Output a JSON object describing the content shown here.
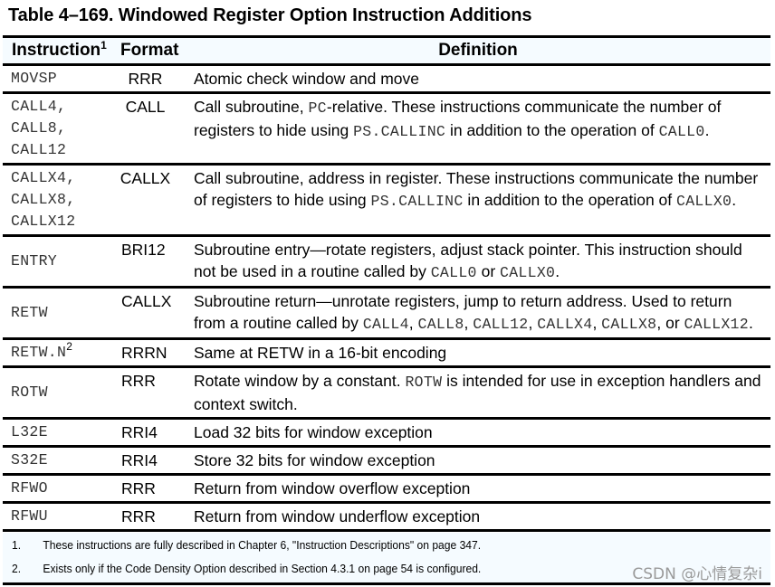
{
  "caption": "Table 4–169.  Windowed Register Option Instruction Additions",
  "headers": {
    "instruction": "Instruction",
    "instruction_sup": "1",
    "format": "Format",
    "definition": "Definition"
  },
  "rows": [
    {
      "ins": [
        "MOVSP"
      ],
      "fmt": "RRR",
      "def": [
        {
          "t": "Atomic check window and move"
        }
      ]
    },
    {
      "ins": [
        "CALL4,",
        "CALL8,",
        "CALL12"
      ],
      "fmt": "CALL",
      "def": [
        {
          "t": "Call subroutine, "
        },
        {
          "m": "PC"
        },
        {
          "t": "-relative. These instructions communicate the number of registers to hide using "
        },
        {
          "m": "PS.CALLINC"
        },
        {
          "t": " in addition to the operation of "
        },
        {
          "m": "CALL0"
        },
        {
          "t": "."
        }
      ]
    },
    {
      "ins": [
        "CALLX4,",
        "CALLX8,",
        "CALLX12"
      ],
      "fmt": "CALLX",
      "def": [
        {
          "t": "Call subroutine, address in register. These instructions communicate the number of registers to hide using "
        },
        {
          "m": "PS.CALLINC"
        },
        {
          "t": " in addition to the operation of "
        },
        {
          "m": "CALLX0"
        },
        {
          "t": "."
        }
      ]
    },
    {
      "ins": [
        "ENTRY"
      ],
      "fmt": "BRI12",
      "def": [
        {
          "t": "Subroutine entry—rotate registers, adjust stack pointer. This instruction should not be used in a routine called by "
        },
        {
          "m": "CALL0"
        },
        {
          "t": " or "
        },
        {
          "m": "CALLX0"
        },
        {
          "t": "."
        }
      ]
    },
    {
      "ins": [
        "RETW"
      ],
      "fmt": "CALLX",
      "def": [
        {
          "t": "Subroutine return—unrotate registers, jump to return address. Used to return from a routine called by "
        },
        {
          "m": "CALL4"
        },
        {
          "t": ", "
        },
        {
          "m": "CALL8"
        },
        {
          "t": ", "
        },
        {
          "m": "CALL12"
        },
        {
          "t": ", "
        },
        {
          "m": "CALLX4"
        },
        {
          "t": ", "
        },
        {
          "m": "CALLX8"
        },
        {
          "t": ", or "
        },
        {
          "m": "CALLX12"
        },
        {
          "t": "."
        }
      ]
    },
    {
      "ins": [
        "RETW.N"
      ],
      "ins_sup": "2",
      "fmt": "RRRN",
      "def": [
        {
          "t": "Same at RETW in a 16-bit encoding"
        }
      ]
    },
    {
      "ins": [
        "ROTW"
      ],
      "fmt": "RRR",
      "def": [
        {
          "t": "Rotate window by a constant. "
        },
        {
          "m": "ROTW"
        },
        {
          "t": " is intended for use in exception handlers and context switch."
        }
      ]
    },
    {
      "ins": [
        "L32E"
      ],
      "fmt": "RRI4",
      "def": [
        {
          "t": "Load 32 bits for window exception"
        }
      ]
    },
    {
      "ins": [
        "S32E"
      ],
      "fmt": "RRI4",
      "def": [
        {
          "t": "Store 32 bits for window exception"
        }
      ]
    },
    {
      "ins": [
        "RFWO"
      ],
      "fmt": "RRR",
      "def": [
        {
          "t": "Return from window overflow exception"
        }
      ]
    },
    {
      "ins": [
        "RFWU"
      ],
      "fmt": "RRR",
      "def": [
        {
          "t": "Return from window underflow exception"
        }
      ]
    }
  ],
  "footnotes": [
    {
      "num": "1.",
      "text": "These instructions are fully described in Chapter 6, \"Instruction Descriptions\" on page 347."
    },
    {
      "num": "2.",
      "text": "Exists only if the Code Density Option described in Section 4.3.1 on page 54 is configured."
    }
  ],
  "watermark": "CSDN @心情复杂i"
}
